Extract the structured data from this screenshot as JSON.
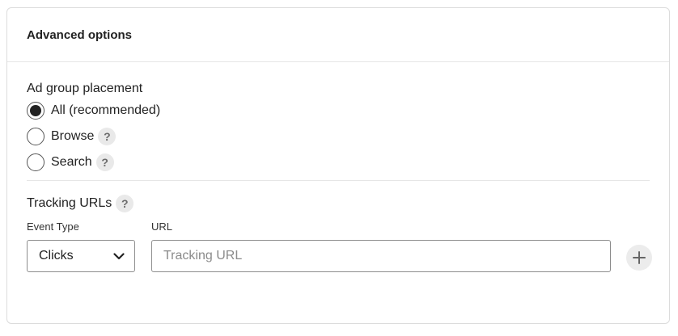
{
  "card": {
    "title": "Advanced options"
  },
  "placement": {
    "label": "Ad group placement",
    "options": [
      {
        "label": "All (recommended)",
        "selected": true,
        "help": false
      },
      {
        "label": "Browse",
        "selected": false,
        "help": true
      },
      {
        "label": "Search",
        "selected": false,
        "help": true
      }
    ]
  },
  "tracking": {
    "title": "Tracking URLs",
    "event_type_label": "Event Type",
    "url_label": "URL",
    "event_type_value": "Clicks",
    "url_placeholder": "Tracking URL",
    "url_value": ""
  },
  "icons": {
    "help": "?",
    "help_icon": "question-icon",
    "chevron": "chevron-down-icon",
    "add": "plus-icon"
  }
}
